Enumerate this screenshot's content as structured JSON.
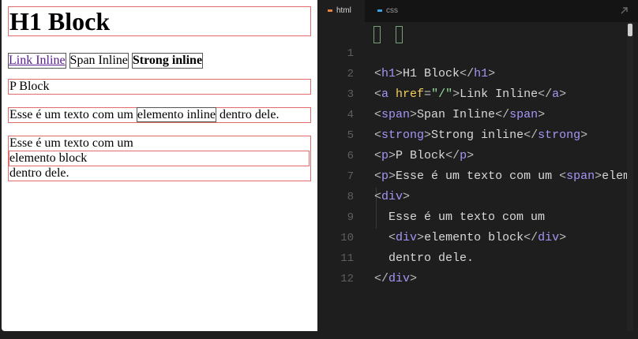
{
  "preview": {
    "h1": "H1 Block",
    "link": "Link Inline",
    "span": "Span Inline",
    "strong": "Strong inline",
    "p_block": "P Block",
    "p_inline": {
      "before": "Esse é um texto com um ",
      "inner": "elemento inline",
      "after": " dentro dele."
    },
    "div_block": {
      "before": "Esse é um texto com um",
      "inner": "elemento block",
      "after": "dentro dele."
    }
  },
  "tabs": [
    {
      "label": "html",
      "color": "#e8823a"
    },
    {
      "label": "css",
      "color": "#3aa0e8"
    }
  ],
  "code": {
    "line_numbers": [
      "1",
      "2",
      "3",
      "4",
      "5",
      "6",
      "7",
      "8",
      "9",
      "10",
      "11",
      "12"
    ],
    "l1": {
      "o": "<",
      "tag": "h1",
      "c": ">",
      "text": "H1 Block",
      "eo": "</",
      "etag": "h1",
      "ec": ">"
    },
    "l2": {
      "o": "<",
      "tag": "a",
      "attr": " href",
      "eq": "=",
      "val": "\"/\"",
      "c": ">",
      "text": "Link Inline",
      "eo": "</",
      "etag": "a",
      "ec": ">"
    },
    "l3": {
      "o": "<",
      "tag": "span",
      "c": ">",
      "text": "Span Inline",
      "eo": "</",
      "etag": "span",
      "ec": ">"
    },
    "l4": {
      "o": "<",
      "tag": "strong",
      "c": ">",
      "text": "Strong inline",
      "eo": "</",
      "etag": "strong",
      "ec": ">"
    },
    "l5": {
      "o": "<",
      "tag": "p",
      "c": ">",
      "text": "P Block",
      "eo": "</",
      "etag": "p",
      "ec": ">"
    },
    "l6": {
      "o": "<",
      "tag": "p",
      "c": ">",
      "text": "Esse é um texto com um ",
      "io": "<",
      "itag": "span",
      "ic": ">",
      "rest": "elemento inline"
    },
    "l7": {
      "o": "<",
      "tag": "div",
      "c": ">"
    },
    "l8": {
      "text": "  Esse é um texto com um"
    },
    "l9": {
      "indent": "  ",
      "o": "<",
      "tag": "div",
      "c": ">",
      "text": "elemento block",
      "eo": "</",
      "etag": "div",
      "ec": ">"
    },
    "l10": {
      "text": "  dentro dele."
    },
    "l11": {
      "eo": "</",
      "etag": "div",
      "ec": ">"
    }
  }
}
